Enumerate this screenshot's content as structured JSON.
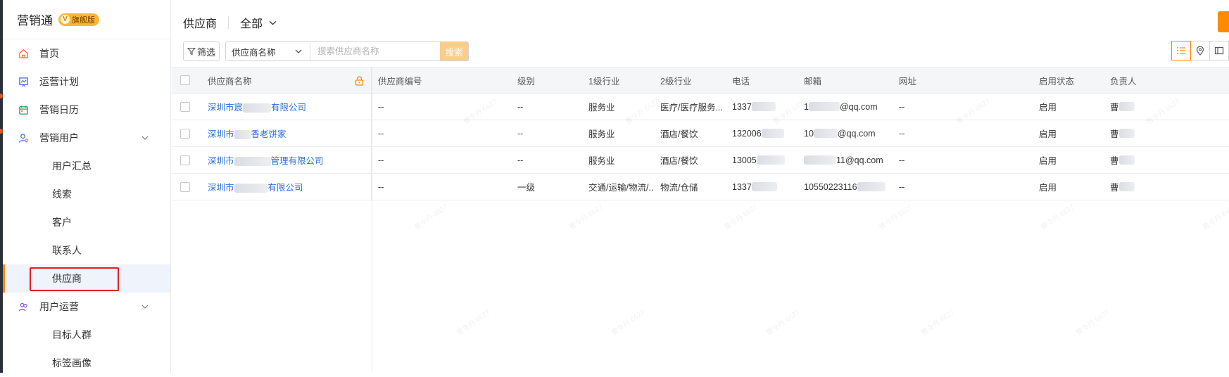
{
  "brand": {
    "name": "营销通",
    "badge": "旗舰版"
  },
  "nav": {
    "home": "首页",
    "plan": "运营计划",
    "calendar": "营销日历",
    "users": "营销用户",
    "users_children": [
      "用户汇总",
      "线索",
      "客户",
      "联系人",
      "供应商"
    ],
    "ops": "用户运营",
    "ops_children": [
      "目标人群",
      "标签画像"
    ]
  },
  "header": {
    "title": "供应商",
    "view": "全部"
  },
  "toolbar": {
    "filter_label": "筛选",
    "field_select": "供应商名称",
    "search_placeholder": "搜索供应商名称",
    "search_label": "搜索"
  },
  "table": {
    "columns": [
      "供应商名称",
      "供应商编号",
      "级别",
      "1级行业",
      "2级行业",
      "电话",
      "邮箱",
      "网址",
      "启用状态",
      "负责人"
    ],
    "rows": [
      {
        "name_a": "深圳市宸",
        "name_b": "有限公司",
        "code": "--",
        "level": "--",
        "ind1": "服务业",
        "ind2": "医疗/医疗服务...",
        "phone": "1337",
        "email_a": "1",
        "email_b": "@qq.com",
        "url": "--",
        "status": "启用",
        "owner": "曹"
      },
      {
        "name_a": "深圳市",
        "name_b": "香老饼家",
        "code": "--",
        "level": "--",
        "ind1": "服务业",
        "ind2": "酒店/餐饮",
        "phone": "132006",
        "email_a": "10",
        "email_b": "@qq.com",
        "url": "--",
        "status": "启用",
        "owner": "曹"
      },
      {
        "name_a": "深圳市",
        "name_b": "管理有限公司",
        "code": "--",
        "level": "--",
        "ind1": "服务业",
        "ind2": "酒店/餐饮",
        "phone": "13005",
        "email_a": "",
        "email_b": "11@qq.com",
        "url": "--",
        "status": "启用",
        "owner": "曹"
      },
      {
        "name_a": "深圳市",
        "name_b": "有限公司",
        "code": "--",
        "level": "一级",
        "ind1": "交通/运输/物流/...",
        "ind2": "物流/仓储",
        "phone": "1337",
        "email_a": "10550223116",
        "email_b": "",
        "url": "--",
        "status": "启用",
        "owner": "曹"
      }
    ]
  },
  "watermark": "曹令丹 6627",
  "colors": {
    "accent": "#ff8a00",
    "link": "#2c6dd2",
    "active_bg": "#eff3fb",
    "highlight": "#e02020"
  }
}
